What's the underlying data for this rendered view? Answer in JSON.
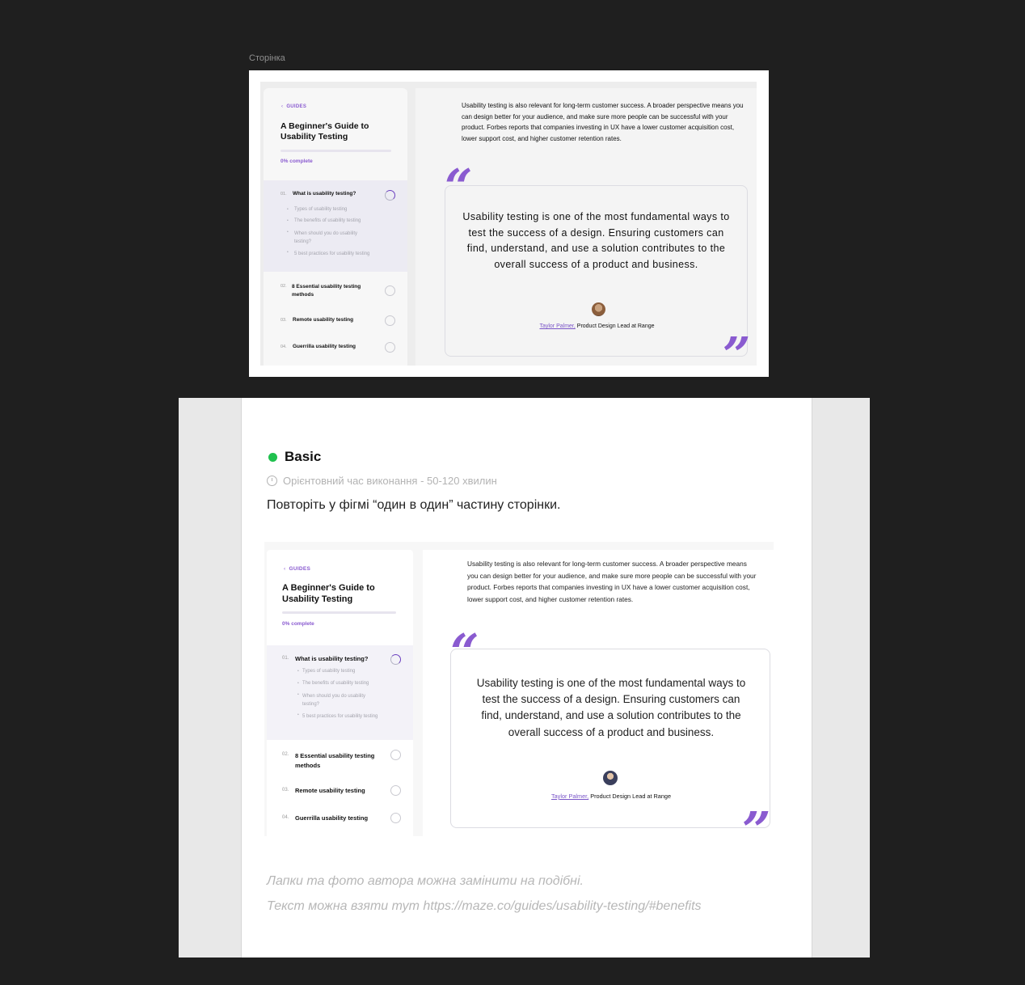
{
  "frame": {
    "label": "Сторінка"
  },
  "guide": {
    "back_label": "GUIDES",
    "title_line1": "A Beginner's Guide to",
    "title_line2": "Usability Testing",
    "progress_percent": 0,
    "progress_label": "0% complete",
    "sections": [
      {
        "number": "01.",
        "title": "What is usability testing?",
        "subitems": [
          "Types of usability testing",
          "The benefits of usability testing",
          "When should you do usability testing?",
          "5 best practices for usability testing"
        ]
      },
      {
        "number": "02.",
        "title": "8 Essential usability testing methods"
      },
      {
        "number": "03.",
        "title": "Remote usability testing"
      },
      {
        "number": "04.",
        "title": "Guerrilla usability testing"
      }
    ],
    "paragraph": "Usability testing is also relevant for long-term customer success. A broader perspective means you can design better for your audience, and make sure more people can be successful with your product. Forbes reports that companies investing in UX have a lower customer acquisition cost, lower support cost, and higher customer retention rates.",
    "quote": "Usability testing is one of the most fundamental ways to test the success of a design. Ensuring customers can find, understand, and use a solution contributes to the overall success of a product and business.",
    "author_name": "Taylor Palmer,",
    "author_role": " Product Design Lead at Range",
    "open_quote": "“",
    "close_quote": "”",
    "accent_color": "#8a5bd0"
  },
  "task": {
    "level": "Basic",
    "level_color": "#20c14e",
    "time": "Орієнтовний час виконання - 50-120 хвилин",
    "instruction": "Повторіть у фігмі “один в один” частину сторінки.",
    "hint1": "Лапки та фото автора можна замінити на подібні.",
    "hint2": "Текст можна взяти тут https://maze.co/guides/usability-testing/#benefits"
  }
}
